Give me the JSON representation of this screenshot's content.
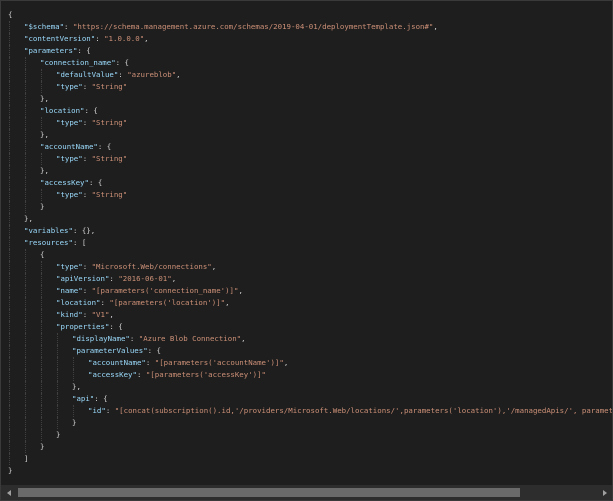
{
  "theme": {
    "background": "#1e1e1e",
    "key_color": "#9cdcfe",
    "string_color": "#ce9178",
    "punctuation_color": "#d4d4d4"
  },
  "scroll": {
    "horizontal_thumb_fraction": 0.87,
    "horizontal_position_fraction": 0.0
  },
  "code": {
    "lines": [
      {
        "indent": 0,
        "tokens": [
          {
            "t": "p",
            "v": "{"
          }
        ]
      },
      {
        "indent": 1,
        "tokens": [
          {
            "t": "k",
            "v": "\"$schema\""
          },
          {
            "t": "p",
            "v": ": "
          },
          {
            "t": "s",
            "v": "\"https://schema.management.azure.com/schemas/2019-04-01/deploymentTemplate.json#\""
          },
          {
            "t": "p",
            "v": ","
          }
        ]
      },
      {
        "indent": 1,
        "tokens": [
          {
            "t": "k",
            "v": "\"contentVersion\""
          },
          {
            "t": "p",
            "v": ": "
          },
          {
            "t": "s",
            "v": "\"1.0.0.0\""
          },
          {
            "t": "p",
            "v": ","
          }
        ]
      },
      {
        "indent": 1,
        "tokens": [
          {
            "t": "k",
            "v": "\"parameters\""
          },
          {
            "t": "p",
            "v": ": {"
          }
        ]
      },
      {
        "indent": 2,
        "tokens": [
          {
            "t": "k",
            "v": "\"connection_name\""
          },
          {
            "t": "p",
            "v": ": {"
          }
        ]
      },
      {
        "indent": 3,
        "tokens": [
          {
            "t": "k",
            "v": "\"defaultValue\""
          },
          {
            "t": "p",
            "v": ": "
          },
          {
            "t": "s",
            "v": "\"azureblob\""
          },
          {
            "t": "p",
            "v": ","
          }
        ]
      },
      {
        "indent": 3,
        "tokens": [
          {
            "t": "k",
            "v": "\"type\""
          },
          {
            "t": "p",
            "v": ": "
          },
          {
            "t": "s",
            "v": "\"String\""
          }
        ]
      },
      {
        "indent": 2,
        "tokens": [
          {
            "t": "p",
            "v": "},"
          }
        ]
      },
      {
        "indent": 2,
        "tokens": [
          {
            "t": "k",
            "v": "\"location\""
          },
          {
            "t": "p",
            "v": ": {"
          }
        ]
      },
      {
        "indent": 3,
        "tokens": [
          {
            "t": "k",
            "v": "\"type\""
          },
          {
            "t": "p",
            "v": ": "
          },
          {
            "t": "s",
            "v": "\"String\""
          }
        ]
      },
      {
        "indent": 2,
        "tokens": [
          {
            "t": "p",
            "v": "},"
          }
        ]
      },
      {
        "indent": 2,
        "tokens": [
          {
            "t": "k",
            "v": "\"accountName\""
          },
          {
            "t": "p",
            "v": ": {"
          }
        ]
      },
      {
        "indent": 3,
        "tokens": [
          {
            "t": "k",
            "v": "\"type\""
          },
          {
            "t": "p",
            "v": ": "
          },
          {
            "t": "s",
            "v": "\"String\""
          }
        ]
      },
      {
        "indent": 2,
        "tokens": [
          {
            "t": "p",
            "v": "},"
          }
        ]
      },
      {
        "indent": 2,
        "tokens": [
          {
            "t": "k",
            "v": "\"accessKey\""
          },
          {
            "t": "p",
            "v": ": {"
          }
        ]
      },
      {
        "indent": 3,
        "tokens": [
          {
            "t": "k",
            "v": "\"type\""
          },
          {
            "t": "p",
            "v": ": "
          },
          {
            "t": "s",
            "v": "\"String\""
          }
        ]
      },
      {
        "indent": 2,
        "tokens": [
          {
            "t": "p",
            "v": "}"
          }
        ]
      },
      {
        "indent": 1,
        "tokens": [
          {
            "t": "p",
            "v": "},"
          }
        ]
      },
      {
        "indent": 1,
        "tokens": [
          {
            "t": "k",
            "v": "\"variables\""
          },
          {
            "t": "p",
            "v": ": {},"
          }
        ]
      },
      {
        "indent": 1,
        "tokens": [
          {
            "t": "k",
            "v": "\"resources\""
          },
          {
            "t": "p",
            "v": ": ["
          }
        ]
      },
      {
        "indent": 2,
        "tokens": [
          {
            "t": "p",
            "v": "{"
          }
        ]
      },
      {
        "indent": 3,
        "tokens": [
          {
            "t": "k",
            "v": "\"type\""
          },
          {
            "t": "p",
            "v": ": "
          },
          {
            "t": "s",
            "v": "\"Microsoft.Web/connections\""
          },
          {
            "t": "p",
            "v": ","
          }
        ]
      },
      {
        "indent": 3,
        "tokens": [
          {
            "t": "k",
            "v": "\"apiVersion\""
          },
          {
            "t": "p",
            "v": ": "
          },
          {
            "t": "s",
            "v": "\"2016-06-01\""
          },
          {
            "t": "p",
            "v": ","
          }
        ]
      },
      {
        "indent": 3,
        "tokens": [
          {
            "t": "k",
            "v": "\"name\""
          },
          {
            "t": "p",
            "v": ": "
          },
          {
            "t": "s",
            "v": "\"[parameters('connection_name')]\""
          },
          {
            "t": "p",
            "v": ","
          }
        ]
      },
      {
        "indent": 3,
        "tokens": [
          {
            "t": "k",
            "v": "\"location\""
          },
          {
            "t": "p",
            "v": ": "
          },
          {
            "t": "s",
            "v": "\"[parameters('location')]\""
          },
          {
            "t": "p",
            "v": ","
          }
        ]
      },
      {
        "indent": 3,
        "tokens": [
          {
            "t": "k",
            "v": "\"kind\""
          },
          {
            "t": "p",
            "v": ": "
          },
          {
            "t": "s",
            "v": "\"V1\""
          },
          {
            "t": "p",
            "v": ","
          }
        ]
      },
      {
        "indent": 3,
        "tokens": [
          {
            "t": "k",
            "v": "\"properties\""
          },
          {
            "t": "p",
            "v": ": {"
          }
        ]
      },
      {
        "indent": 4,
        "tokens": [
          {
            "t": "k",
            "v": "\"displayName\""
          },
          {
            "t": "p",
            "v": ": "
          },
          {
            "t": "s",
            "v": "\"Azure Blob Connection\""
          },
          {
            "t": "p",
            "v": ","
          }
        ]
      },
      {
        "indent": 4,
        "tokens": [
          {
            "t": "k",
            "v": "\"parameterValues\""
          },
          {
            "t": "p",
            "v": ": {"
          }
        ]
      },
      {
        "indent": 5,
        "tokens": [
          {
            "t": "k",
            "v": "\"accountName\""
          },
          {
            "t": "p",
            "v": ": "
          },
          {
            "t": "s",
            "v": "\"[parameters('accountName')]\""
          },
          {
            "t": "p",
            "v": ","
          }
        ]
      },
      {
        "indent": 5,
        "tokens": [
          {
            "t": "k",
            "v": "\"accessKey\""
          },
          {
            "t": "p",
            "v": ": "
          },
          {
            "t": "s",
            "v": "\"[parameters('accessKey')]\""
          }
        ]
      },
      {
        "indent": 4,
        "tokens": [
          {
            "t": "p",
            "v": "},"
          }
        ]
      },
      {
        "indent": 4,
        "tokens": [
          {
            "t": "k",
            "v": "\"api\""
          },
          {
            "t": "p",
            "v": ": {"
          }
        ]
      },
      {
        "indent": 5,
        "tokens": [
          {
            "t": "k",
            "v": "\"id\""
          },
          {
            "t": "p",
            "v": ": "
          },
          {
            "t": "s",
            "v": "\"[concat(subscription().id,'/providers/Microsoft.Web/locations/',parameters('location'),'/managedApis/', parameters('connecti"
          }
        ]
      },
      {
        "indent": 4,
        "tokens": [
          {
            "t": "p",
            "v": "}"
          }
        ]
      },
      {
        "indent": 3,
        "tokens": [
          {
            "t": "p",
            "v": "}"
          }
        ]
      },
      {
        "indent": 2,
        "tokens": [
          {
            "t": "p",
            "v": "}"
          }
        ]
      },
      {
        "indent": 1,
        "tokens": [
          {
            "t": "p",
            "v": "]"
          }
        ]
      },
      {
        "indent": 0,
        "tokens": [
          {
            "t": "p",
            "v": "}"
          }
        ]
      }
    ]
  }
}
